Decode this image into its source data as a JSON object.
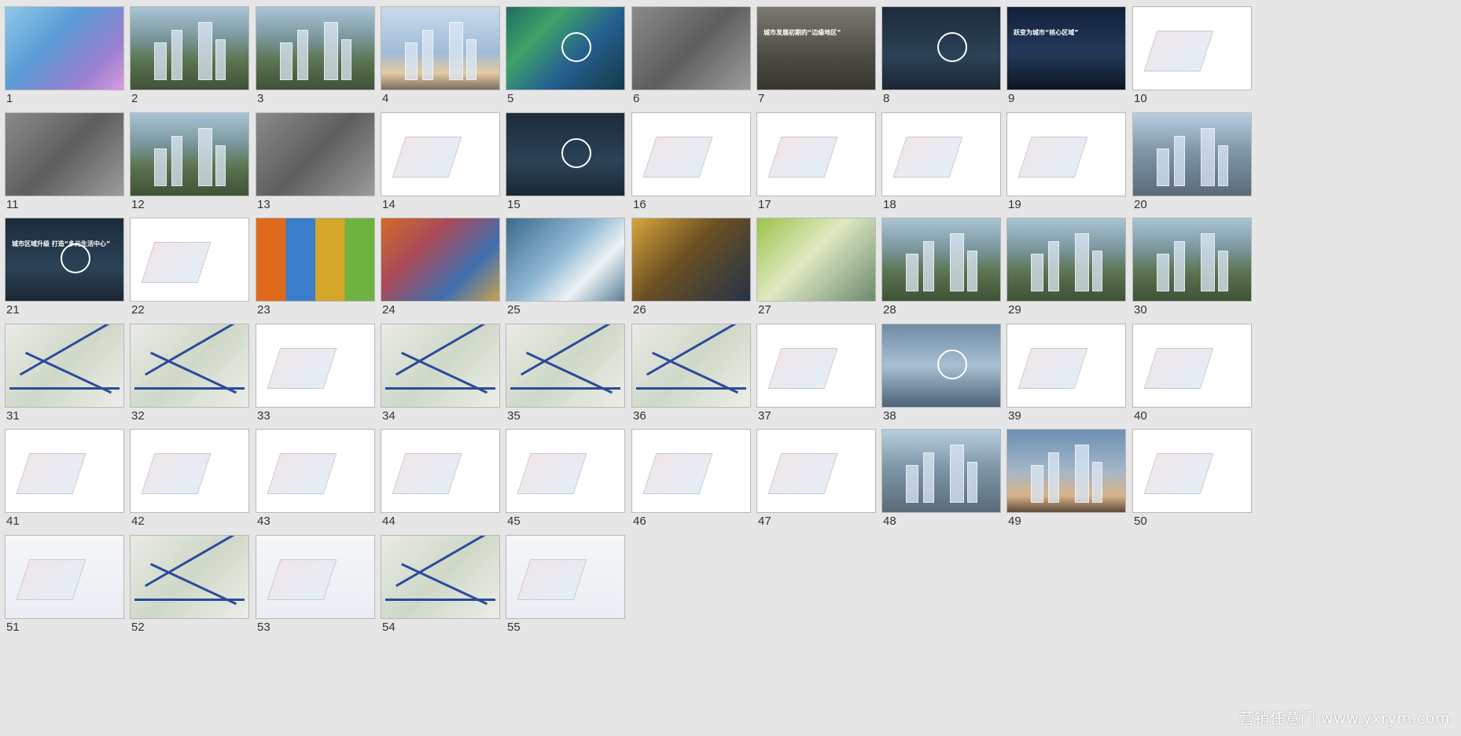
{
  "slides": [
    {
      "num": "1",
      "style": "s-sky",
      "caption": "",
      "caption_color": "white"
    },
    {
      "num": "2",
      "style": "s-aerial",
      "caption": "",
      "caption_color": "white"
    },
    {
      "num": "3",
      "style": "s-aerial",
      "caption": "",
      "caption_color": "white"
    },
    {
      "num": "4",
      "style": "s-tower",
      "caption": "",
      "caption_color": "white"
    },
    {
      "num": "5",
      "style": "s-green",
      "caption": "",
      "caption_color": "white"
    },
    {
      "num": "6",
      "style": "s-map",
      "caption": "",
      "caption_color": "white"
    },
    {
      "num": "7",
      "style": "s-photo-dark",
      "caption": "城市发展初期的“边缘地区”",
      "caption_color": "white"
    },
    {
      "num": "8",
      "style": "s-darkblue",
      "caption": "",
      "caption_color": "white"
    },
    {
      "num": "9",
      "style": "s-night",
      "caption": "跃变为城市“核心区域”",
      "caption_color": "white"
    },
    {
      "num": "10",
      "style": "s-white",
      "caption": "",
      "caption_color": "dark"
    },
    {
      "num": "11",
      "style": "s-map",
      "caption": "",
      "caption_color": "white"
    },
    {
      "num": "12",
      "style": "s-aerial",
      "caption": "",
      "caption_color": "white"
    },
    {
      "num": "13",
      "style": "s-map",
      "caption": "",
      "caption_color": "white"
    },
    {
      "num": "14",
      "style": "s-white",
      "caption": "",
      "caption_color": "dark"
    },
    {
      "num": "15",
      "style": "s-darkblue",
      "caption": "",
      "caption_color": "white"
    },
    {
      "num": "16",
      "style": "s-white",
      "caption": "",
      "caption_color": "dark"
    },
    {
      "num": "17",
      "style": "s-white",
      "caption": "",
      "caption_color": "dark"
    },
    {
      "num": "18",
      "style": "s-white",
      "caption": "",
      "caption_color": "dark"
    },
    {
      "num": "19",
      "style": "s-white",
      "caption": "",
      "caption_color": "dark"
    },
    {
      "num": "20",
      "style": "s-city",
      "caption": "",
      "caption_color": "white"
    },
    {
      "num": "21",
      "style": "s-darkblue",
      "caption": "城市区域升级 打造“多元生活中心”",
      "caption_color": "white"
    },
    {
      "num": "22",
      "style": "s-white",
      "caption": "",
      "caption_color": "dark"
    },
    {
      "num": "23",
      "style": "s-colorful",
      "caption": "",
      "caption_color": "white"
    },
    {
      "num": "24",
      "style": "s-collage",
      "caption": "",
      "caption_color": "white"
    },
    {
      "num": "25",
      "style": "s-glass",
      "caption": "",
      "caption_color": "white"
    },
    {
      "num": "26",
      "style": "s-gold",
      "caption": "",
      "caption_color": "white"
    },
    {
      "num": "27",
      "style": "s-lime",
      "caption": "",
      "caption_color": "white"
    },
    {
      "num": "28",
      "style": "s-aerial",
      "caption": "",
      "caption_color": "white"
    },
    {
      "num": "29",
      "style": "s-aerial",
      "caption": "",
      "caption_color": "white"
    },
    {
      "num": "30",
      "style": "s-aerial",
      "caption": "",
      "caption_color": "white"
    },
    {
      "num": "31",
      "style": "s-plan",
      "caption": "",
      "caption_color": "dark"
    },
    {
      "num": "32",
      "style": "s-plan",
      "caption": "",
      "caption_color": "dark"
    },
    {
      "num": "33",
      "style": "s-white",
      "caption": "",
      "caption_color": "dark"
    },
    {
      "num": "34",
      "style": "s-plan",
      "caption": "",
      "caption_color": "dark"
    },
    {
      "num": "35",
      "style": "s-plan",
      "caption": "",
      "caption_color": "dark"
    },
    {
      "num": "36",
      "style": "s-plan",
      "caption": "",
      "caption_color": "dark"
    },
    {
      "num": "37",
      "style": "s-white",
      "caption": "",
      "caption_color": "dark"
    },
    {
      "num": "38",
      "style": "s-mall",
      "caption": "",
      "caption_color": "white"
    },
    {
      "num": "39",
      "style": "s-white",
      "caption": "",
      "caption_color": "dark"
    },
    {
      "num": "40",
      "style": "s-white",
      "caption": "",
      "caption_color": "dark"
    },
    {
      "num": "41",
      "style": "s-white",
      "caption": "",
      "caption_color": "dark"
    },
    {
      "num": "42",
      "style": "s-white",
      "caption": "",
      "caption_color": "dark"
    },
    {
      "num": "43",
      "style": "s-white",
      "caption": "",
      "caption_color": "dark"
    },
    {
      "num": "44",
      "style": "s-white",
      "caption": "",
      "caption_color": "dark"
    },
    {
      "num": "45",
      "style": "s-white",
      "caption": "",
      "caption_color": "dark"
    },
    {
      "num": "46",
      "style": "s-white",
      "caption": "",
      "caption_color": "dark"
    },
    {
      "num": "47",
      "style": "s-white",
      "caption": "",
      "caption_color": "dark"
    },
    {
      "num": "48",
      "style": "s-city",
      "caption": "",
      "caption_color": "white"
    },
    {
      "num": "49",
      "style": "s-dusk",
      "caption": "",
      "caption_color": "white"
    },
    {
      "num": "50",
      "style": "s-white",
      "caption": "",
      "caption_color": "dark"
    },
    {
      "num": "51",
      "style": "s-blueprint",
      "caption": "",
      "caption_color": "dark"
    },
    {
      "num": "52",
      "style": "s-plan",
      "caption": "",
      "caption_color": "dark"
    },
    {
      "num": "53",
      "style": "s-blueprint",
      "caption": "",
      "caption_color": "dark"
    },
    {
      "num": "54",
      "style": "s-plan",
      "caption": "",
      "caption_color": "dark"
    },
    {
      "num": "55",
      "style": "s-blueprint",
      "caption": "",
      "caption_color": "dark"
    }
  ],
  "watermark": "营销任意门 www.yxrym.com",
  "colors": {
    "background": "#e6e6e6",
    "thumb_border": "#b8b8b8",
    "road_blue": "#2d4a9a"
  }
}
